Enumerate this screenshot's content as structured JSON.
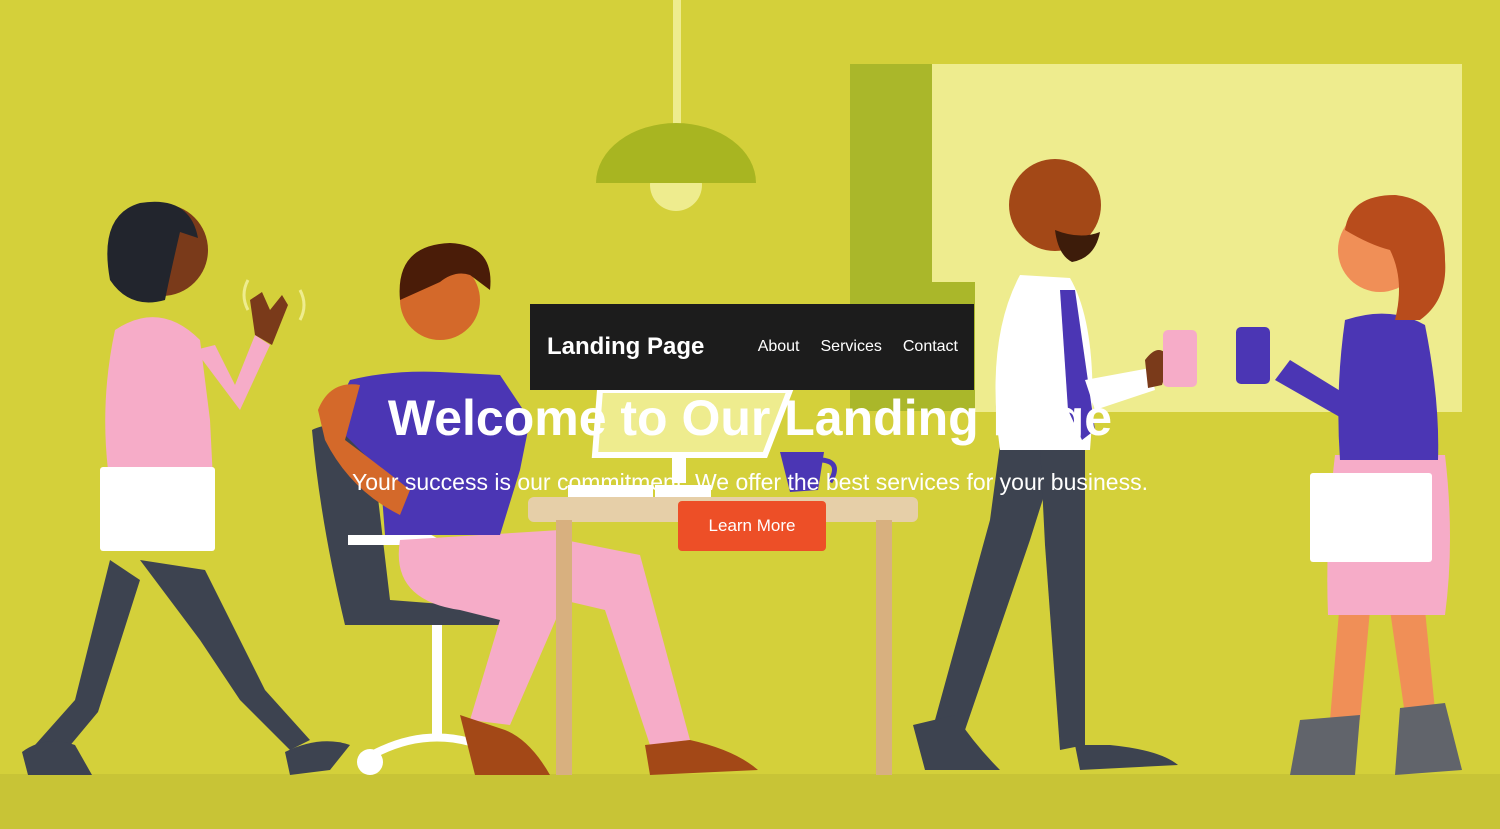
{
  "navbar": {
    "brand": "Landing Page",
    "links": [
      {
        "label": "About"
      },
      {
        "label": "Services"
      },
      {
        "label": "Contact"
      }
    ]
  },
  "hero": {
    "headline": "Welcome to Our Landing Page",
    "subtext": "Your success is our commitment. We offer the best services for your business.",
    "cta_label": "Learn More"
  },
  "illustration": {
    "description_icons": [
      "pendant-lamp-icon",
      "window-icon",
      "desk-icon",
      "office-chair-icon",
      "computer-monitor-icon",
      "coffee-mug-icon",
      "soda-can-icon",
      "tablet-icon"
    ]
  },
  "colors": {
    "background": "#d4d03a",
    "window": "#eeec8e",
    "navbar": "#1c1c1c",
    "cta": "#ed4f27",
    "purple": "#4b36b4",
    "pink": "#f6acc8"
  }
}
